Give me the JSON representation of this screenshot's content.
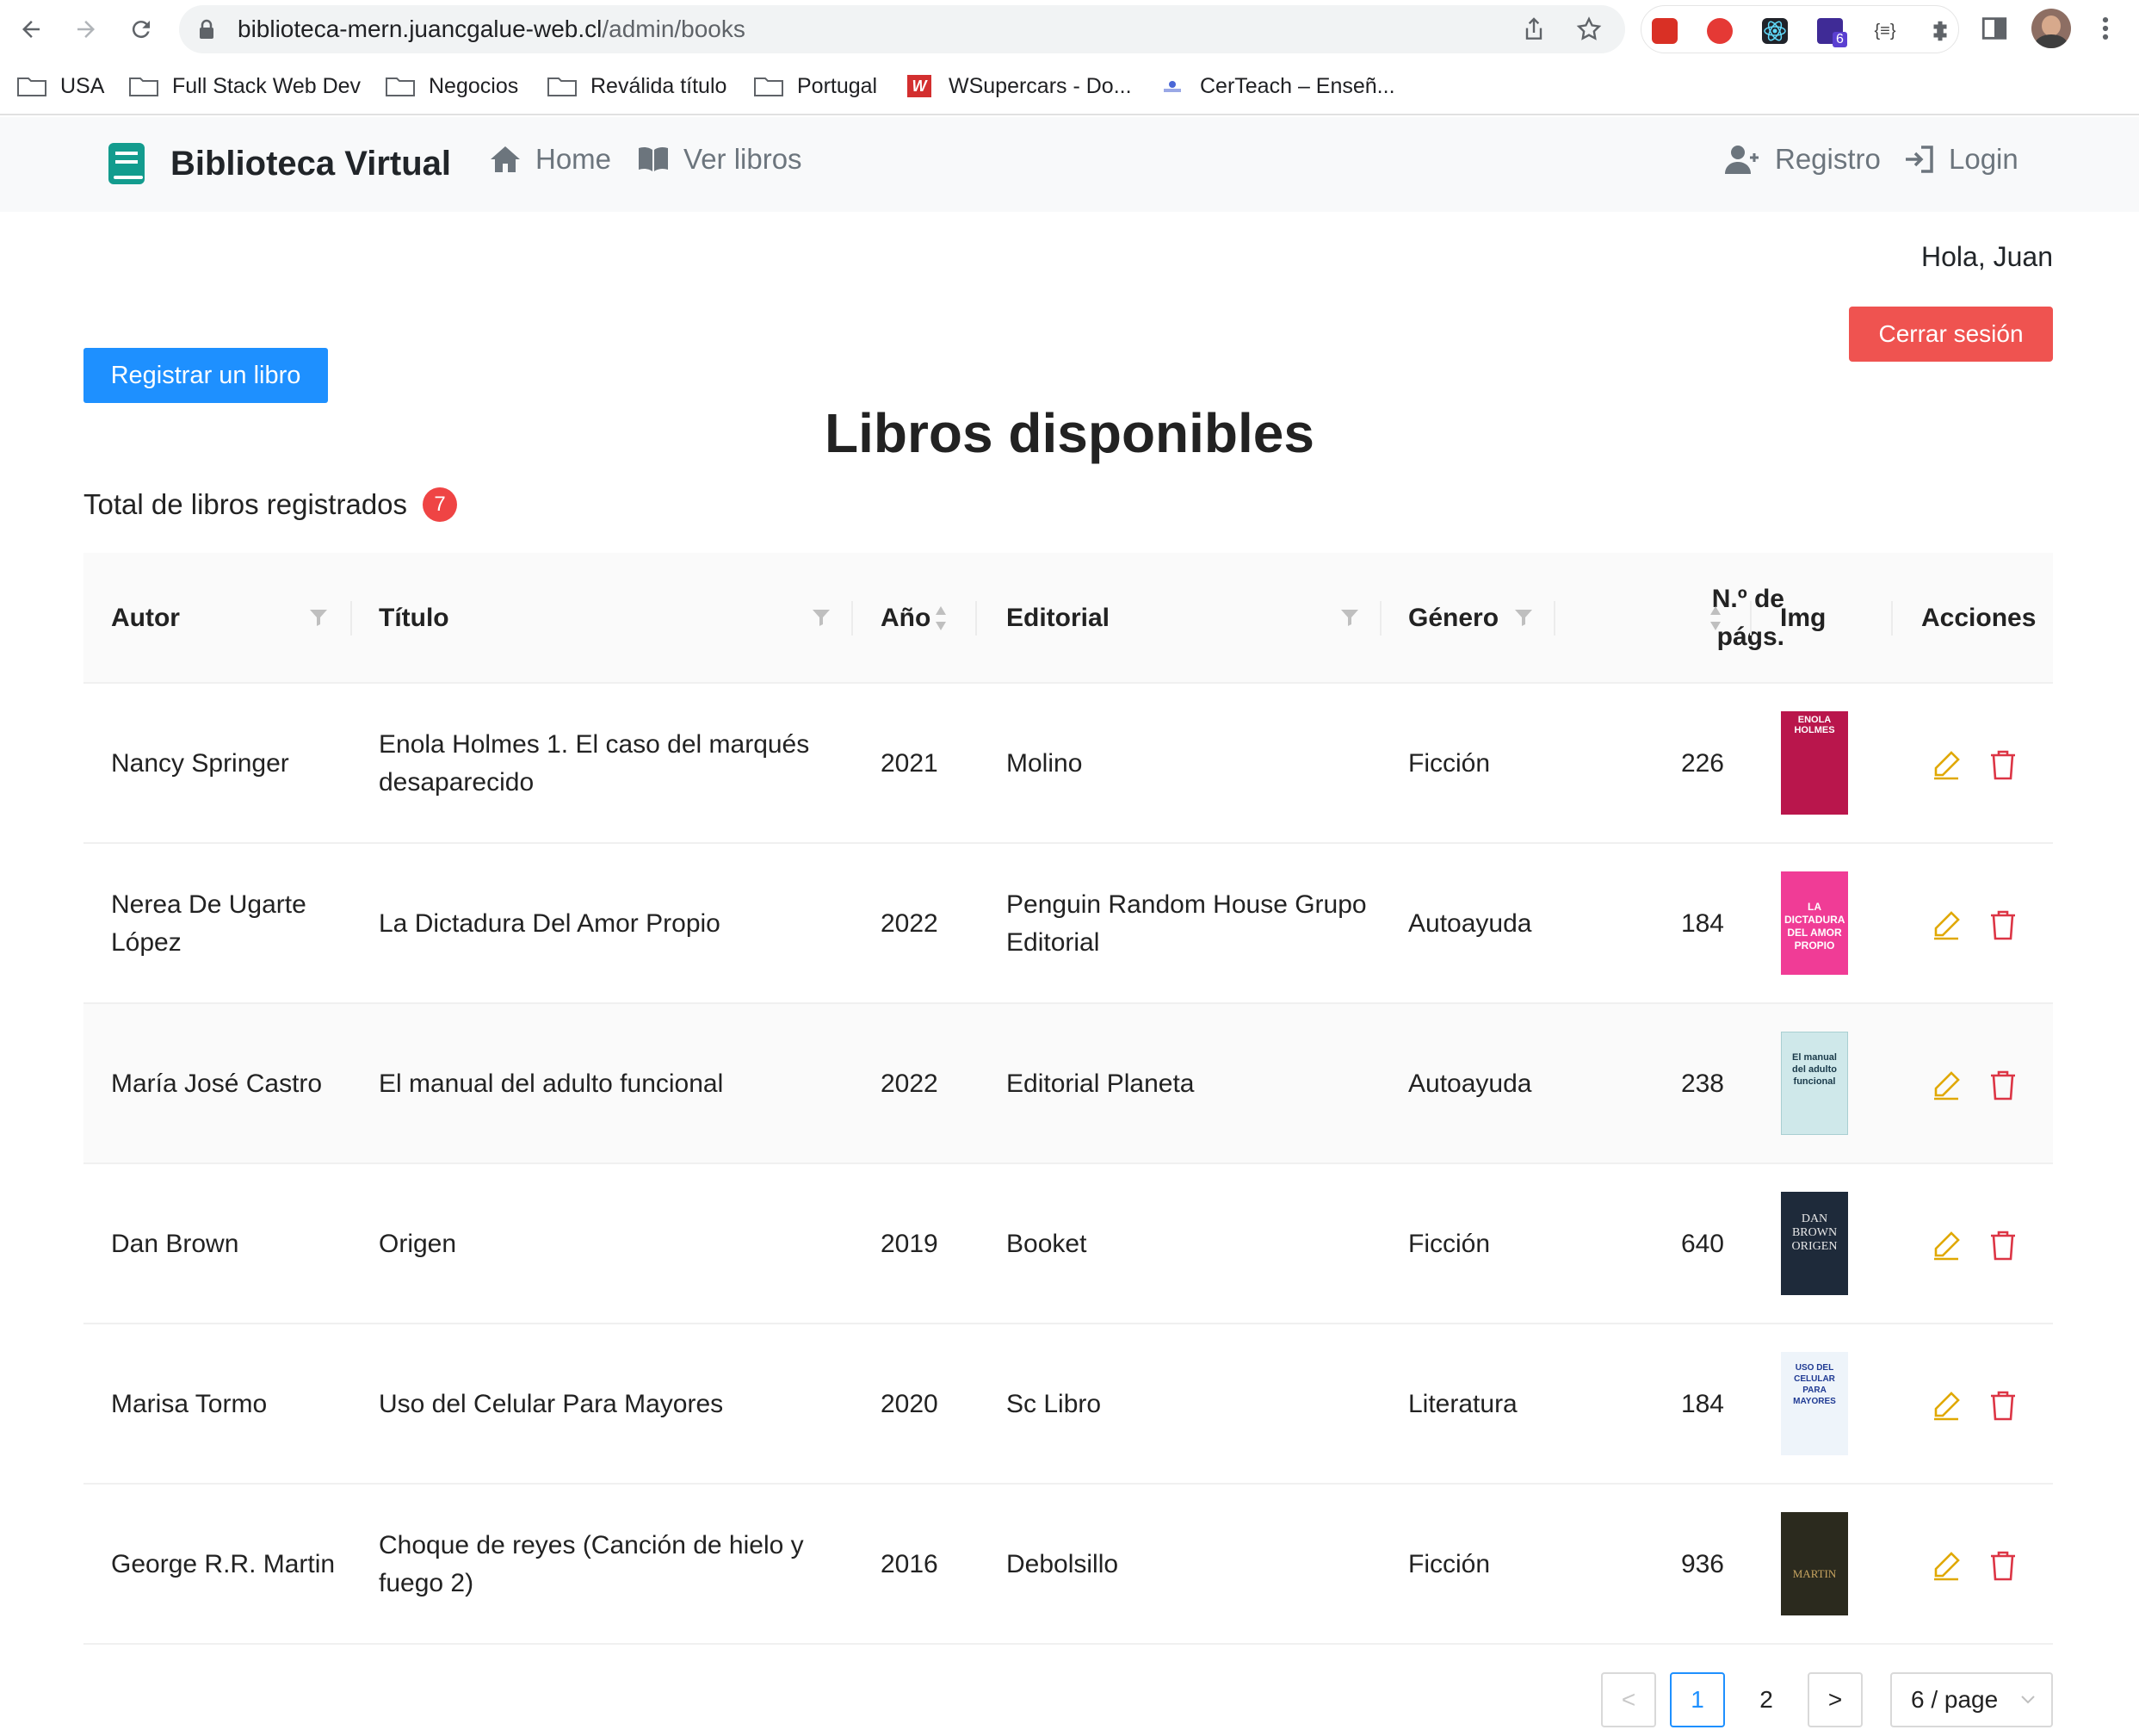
{
  "browser": {
    "url_host": "biblioteca-mern.juancgalue-web.cl",
    "url_path": "/admin/books",
    "extension_badge": "6",
    "bookmarks": [
      {
        "label": "USA",
        "icon": "folder-icon"
      },
      {
        "label": "Full Stack Web Dev",
        "icon": "folder-icon"
      },
      {
        "label": "Negocios",
        "icon": "folder-icon"
      },
      {
        "label": "Reválida título",
        "icon": "folder-icon"
      },
      {
        "label": "Portugal",
        "icon": "folder-icon"
      },
      {
        "label": "WSupercars - Do...",
        "icon": "wsupercars-icon"
      },
      {
        "label": "CerTeach – Enseñ...",
        "icon": "certeach-icon"
      }
    ]
  },
  "navbar": {
    "brand": "Biblioteca Virtual",
    "home": "Home",
    "books": "Ver libros",
    "register": "Registro",
    "login": "Login"
  },
  "user": {
    "greeting": "Hola, Juan",
    "logout": "Cerrar sesión"
  },
  "main": {
    "register_book": "Registrar un libro",
    "title": "Libros disponibles",
    "total_label": "Total de libros registrados",
    "total_count": "7"
  },
  "table": {
    "headers": {
      "autor": "Autor",
      "titulo": "Título",
      "anio": "Año",
      "editorial": "Editorial",
      "genero": "Género",
      "paginas_1": "N.º de",
      "paginas_2": "págs.",
      "img": "Img",
      "acciones": "Acciones"
    },
    "rows": [
      {
        "autor": "Nancy Springer",
        "titulo": "Enola Holmes 1. El caso del marqués desaparecido",
        "anio": "2021",
        "editorial": "Molino",
        "genero": "Ficción",
        "paginas": "226"
      },
      {
        "autor": "Nerea De Ugarte López",
        "titulo": "La Dictadura Del Amor Propio",
        "anio": "2022",
        "editorial": "Penguin Random House Grupo Editorial",
        "genero": "Autoayuda",
        "paginas": "184"
      },
      {
        "autor": "María José Castro",
        "titulo": "El manual del adulto funcional",
        "anio": "2022",
        "editorial": "Editorial Planeta",
        "genero": "Autoayuda",
        "paginas": "238"
      },
      {
        "autor": "Dan Brown",
        "titulo": "Origen",
        "anio": "2019",
        "editorial": "Booket",
        "genero": "Ficción",
        "paginas": "640"
      },
      {
        "autor": "Marisa Tormo",
        "titulo": "Uso del Celular Para Mayores",
        "anio": "2020",
        "editorial": "Sc Libro",
        "genero": "Literatura",
        "paginas": "184"
      },
      {
        "autor": "George R.R. Martin",
        "titulo": "Choque de reyes (Canción de hielo y fuego 2)",
        "anio": "2016",
        "editorial": "Debolsillo",
        "genero": "Ficción",
        "paginas": "936"
      }
    ],
    "covers": [
      {
        "text": "ENOLA HOLMES",
        "color": "#c2185b"
      },
      {
        "text": "LA DICTADURA DEL AMOR PROPIO",
        "color": "#f03c96"
      },
      {
        "text": "El manual del adulto funcional",
        "color": "#cfe8ea"
      },
      {
        "text": "DAN BROWN ORIGEN",
        "color": "#1e2a3a"
      },
      {
        "text": "USO DEL CELULAR PARA MAYORES",
        "color": "#e8f0f8"
      },
      {
        "text": "MARTIN",
        "color": "#2b2a1e"
      }
    ]
  },
  "pagination": {
    "prev": "<",
    "pages": [
      "1",
      "2"
    ],
    "current": "1",
    "next": ">",
    "page_size": "6 / page"
  },
  "colors": {
    "primary": "#1e90ff",
    "danger": "#ef5350",
    "edit_icon": "#e0a800",
    "delete_icon": "#dc3545",
    "brand_icon": "#139c8e"
  }
}
